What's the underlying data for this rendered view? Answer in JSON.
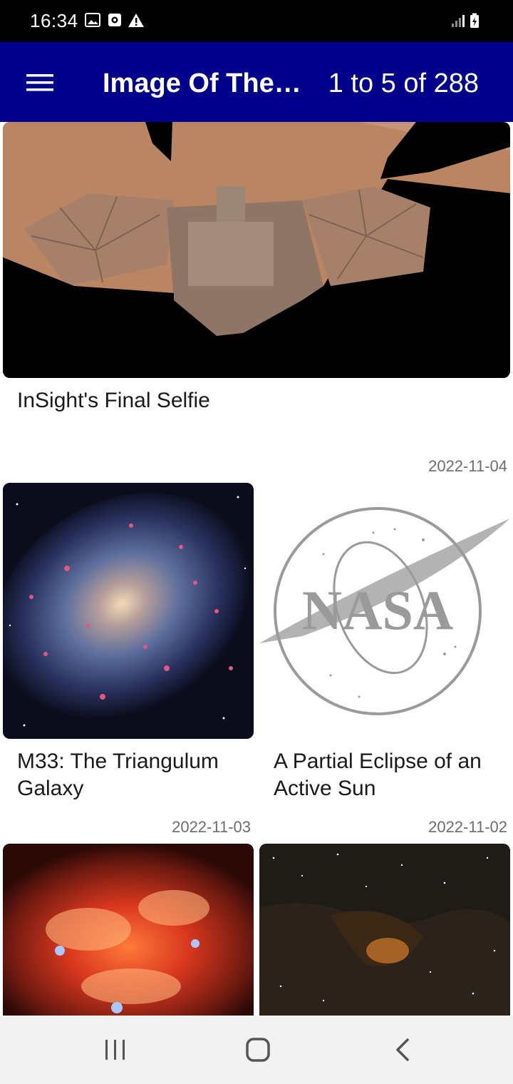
{
  "status_bar": {
    "time": "16:34",
    "icons": [
      "image-icon",
      "camera-notification-icon",
      "warning-icon"
    ],
    "right_icons": [
      "signal-icon",
      "battery-charging-icon"
    ]
  },
  "app_bar": {
    "title": "Image Of The…",
    "page_range": "1 to 5 of 288",
    "menu_icon": "hamburger-menu-icon",
    "color": "#00008b"
  },
  "cards": [
    {
      "title": "InSight's Final Selfie",
      "date": "2022-11-04"
    },
    {
      "title": "M33: The Triangulum Galaxy",
      "date": "2022-11-03"
    },
    {
      "title": "A Partial Eclipse of an Active Sun",
      "date": "2022-11-02"
    },
    {
      "title": "",
      "date": ""
    },
    {
      "title": "",
      "date": ""
    }
  ],
  "nav_bar": {
    "buttons": [
      "recent-apps-icon",
      "home-icon",
      "back-icon"
    ]
  }
}
